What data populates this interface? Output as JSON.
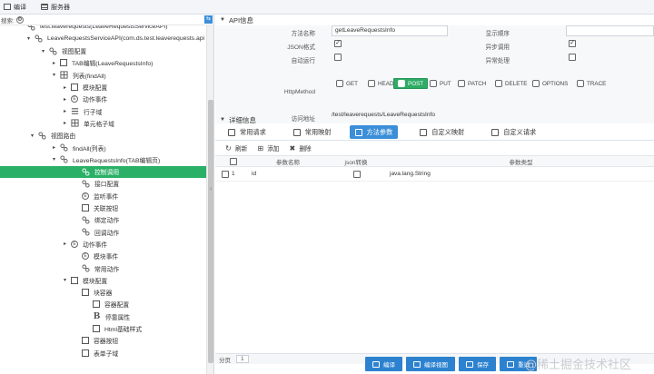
{
  "toolbar": {
    "items": [
      "编译",
      "服务器"
    ]
  },
  "search": {
    "label": "搜索:",
    "value": "",
    "filter_icon": "filter-icon"
  },
  "tree": {
    "rows": [
      {
        "label": "test.leaverequests(LeaveRequestsServiceAPI)",
        "icon": "link",
        "toggle": "",
        "depth": 20
      },
      {
        "label": "LeaveRequestsServiceAPI(com.ds.test.leaverequests.api",
        "icon": "link",
        "toggle": "▾",
        "depth": 28
      },
      {
        "label": "视图配置",
        "icon": "link",
        "toggle": "▾",
        "depth": 44
      },
      {
        "label": "TAB编辑(LeaveRequestsInfo)",
        "icon": "sq",
        "toggle": "▸",
        "depth": 56
      },
      {
        "label": "列表(findAll)",
        "icon": "grid",
        "toggle": "▾",
        "depth": 56
      },
      {
        "label": "模块配置",
        "icon": "sq",
        "toggle": "▸",
        "depth": 68
      },
      {
        "label": "动作事件",
        "icon": "circ",
        "toggle": "▸",
        "depth": 68
      },
      {
        "label": "行子域",
        "icon": "lines",
        "toggle": "▸",
        "depth": 68
      },
      {
        "label": "单元格子域",
        "icon": "grid",
        "toggle": "▸",
        "depth": 68
      },
      {
        "label": "视图路由",
        "icon": "link",
        "toggle": "▾",
        "depth": 32
      },
      {
        "label": "findAll(列表)",
        "icon": "link",
        "toggle": "▸",
        "depth": 56
      },
      {
        "label": "LeaveRequestsInfo(TAB编辑页)",
        "icon": "link",
        "toggle": "▾",
        "depth": 56
      },
      {
        "label": "控制调用",
        "icon": "link",
        "toggle": "",
        "depth": 80,
        "selected": true
      },
      {
        "label": "接口配置",
        "icon": "link",
        "toggle": "",
        "depth": 80
      },
      {
        "label": "监听事件",
        "icon": "circ",
        "toggle": "",
        "depth": 80
      },
      {
        "label": "关联按钮",
        "icon": "sq",
        "toggle": "",
        "depth": 80
      },
      {
        "label": "绑定动作",
        "icon": "link",
        "toggle": "",
        "depth": 80
      },
      {
        "label": "回调动作",
        "icon": "link",
        "toggle": "",
        "depth": 80
      },
      {
        "label": "动作事件",
        "icon": "circ",
        "toggle": "▸",
        "depth": 68
      },
      {
        "label": "模块事件",
        "icon": "circ",
        "toggle": "",
        "depth": 80
      },
      {
        "label": "常用动作",
        "icon": "link",
        "toggle": "",
        "depth": 80
      },
      {
        "label": "模块配置",
        "icon": "sq",
        "toggle": "▾",
        "depth": 68
      },
      {
        "label": "块容器",
        "icon": "sq",
        "toggle": "",
        "depth": 80
      },
      {
        "label": "容器配置",
        "icon": "sq",
        "toggle": "",
        "depth": 92
      },
      {
        "label": "停靠属性",
        "icon": "bold",
        "toggle": "",
        "depth": 92
      },
      {
        "label": "Html基础样式",
        "icon": "sq",
        "toggle": "",
        "depth": 92
      },
      {
        "label": "容器按钮",
        "icon": "sq",
        "toggle": "",
        "depth": 80
      },
      {
        "label": "表单子域",
        "icon": "sq",
        "toggle": "",
        "depth": 80
      }
    ]
  },
  "api": {
    "section_title": "API信息",
    "method_name_label": "方法名称",
    "method_name_value": "getLeaveRequestsInfo",
    "display_order_label": "显示顺序",
    "display_order_value": "",
    "json_label": "JSON格式",
    "async_label": "异步调用",
    "autorun_label": "自动运行",
    "exception_label": "异常处理",
    "http_method_label": "HttpMethod",
    "methods": [
      "GET",
      "HEAD",
      "POST",
      "PUT",
      "PATCH",
      "DELETE",
      "OPTIONS",
      "TRACE"
    ],
    "selected_method": "POST",
    "url_label": "访问地址",
    "url_value": "/test/leaverequests/LeaveRequestsInfo"
  },
  "detail": {
    "section_title": "详细信息",
    "tabs": [
      "常用请求",
      "常用映射",
      "方法参数",
      "自定义映射",
      "自定义请求"
    ],
    "active_tab": "方法参数",
    "actions": [
      "刷新",
      "添加",
      "删除"
    ],
    "columns": [
      "参数名称",
      "json转换",
      "参数类型"
    ],
    "rows": [
      {
        "index": "1",
        "name": "id",
        "json": false,
        "type": "java.lang.String"
      }
    ],
    "pager_label": "分页",
    "pager_value": "1"
  },
  "footer": {
    "buttons": [
      "编译",
      "编译视图",
      "保存",
      "重试"
    ]
  },
  "watermark": "@稀土掘金技术社区"
}
